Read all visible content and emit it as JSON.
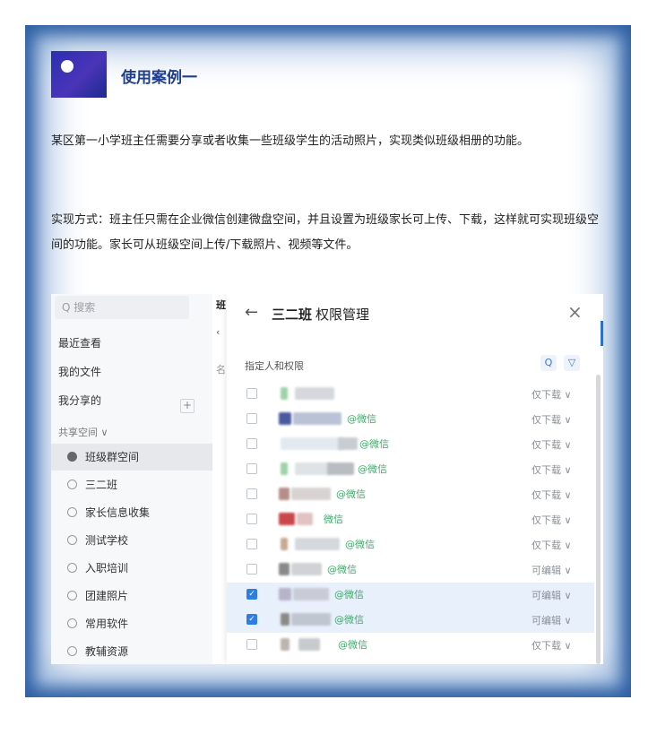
{
  "section": {
    "title": "使用案例一",
    "paragraph1": "某区第一小学班主任需要分享或者收集一些班级学生的活动照片，实现类似班级相册的功能。",
    "paragraph2": "实现方式：班主任只需在企业微信创建微盘空间，并且设置为班级家长可上传、下载，这样就可实现班级空间的功能。家长可从班级空间上传/下载照片、视频等文件。"
  },
  "sidebar": {
    "search_placeholder": "Q 搜索",
    "nav": [
      "最近查看",
      "我的文件",
      "我分享的"
    ],
    "group_label": "共享空间 ∨",
    "add": "+",
    "spaces": [
      "班级群空间",
      "三二班",
      "家长信息收集",
      "测试学校",
      "入职培训",
      "团建照片",
      "常用软件",
      "教辅资源"
    ]
  },
  "behind": {
    "char1": "班",
    "char2": "‹",
    "char3": "名"
  },
  "modal": {
    "back": "←",
    "title_bold": "三二班",
    "title_rest": "权限管理",
    "close": "×",
    "subtitle": "指定人和权限",
    "search_icon": "Q",
    "filter_icon": "▽",
    "rows": [
      {
        "suffix": "",
        "perm": "仅下载 ∨",
        "checked": false
      },
      {
        "suffix": "@微信",
        "perm": "仅下载 ∨",
        "checked": false
      },
      {
        "suffix": "@微信",
        "perm": "仅下载 ∨",
        "checked": false
      },
      {
        "suffix": "@微信",
        "perm": "仅下载 ∨",
        "checked": false
      },
      {
        "suffix": "@微信",
        "perm": "仅下载 ∨",
        "checked": false
      },
      {
        "suffix": "微信",
        "perm": "仅下载 ∨",
        "checked": false
      },
      {
        "suffix": "@微信",
        "perm": "仅下载 ∨",
        "checked": false
      },
      {
        "suffix": "@微信",
        "perm": "可编辑 ∨",
        "checked": false
      },
      {
        "suffix": "@微信",
        "perm": "可编辑 ∨",
        "checked": true
      },
      {
        "suffix": "@微信",
        "perm": "可编辑 ∨",
        "checked": true
      },
      {
        "suffix": "@微信",
        "perm": "仅下载 ∨",
        "checked": false
      }
    ]
  },
  "colors": {
    "accent": "#1f3f8c",
    "frame_glow": "#2d5fa3",
    "wechat_green": "#3fa96a",
    "checkbox_blue": "#2f7ce3"
  }
}
